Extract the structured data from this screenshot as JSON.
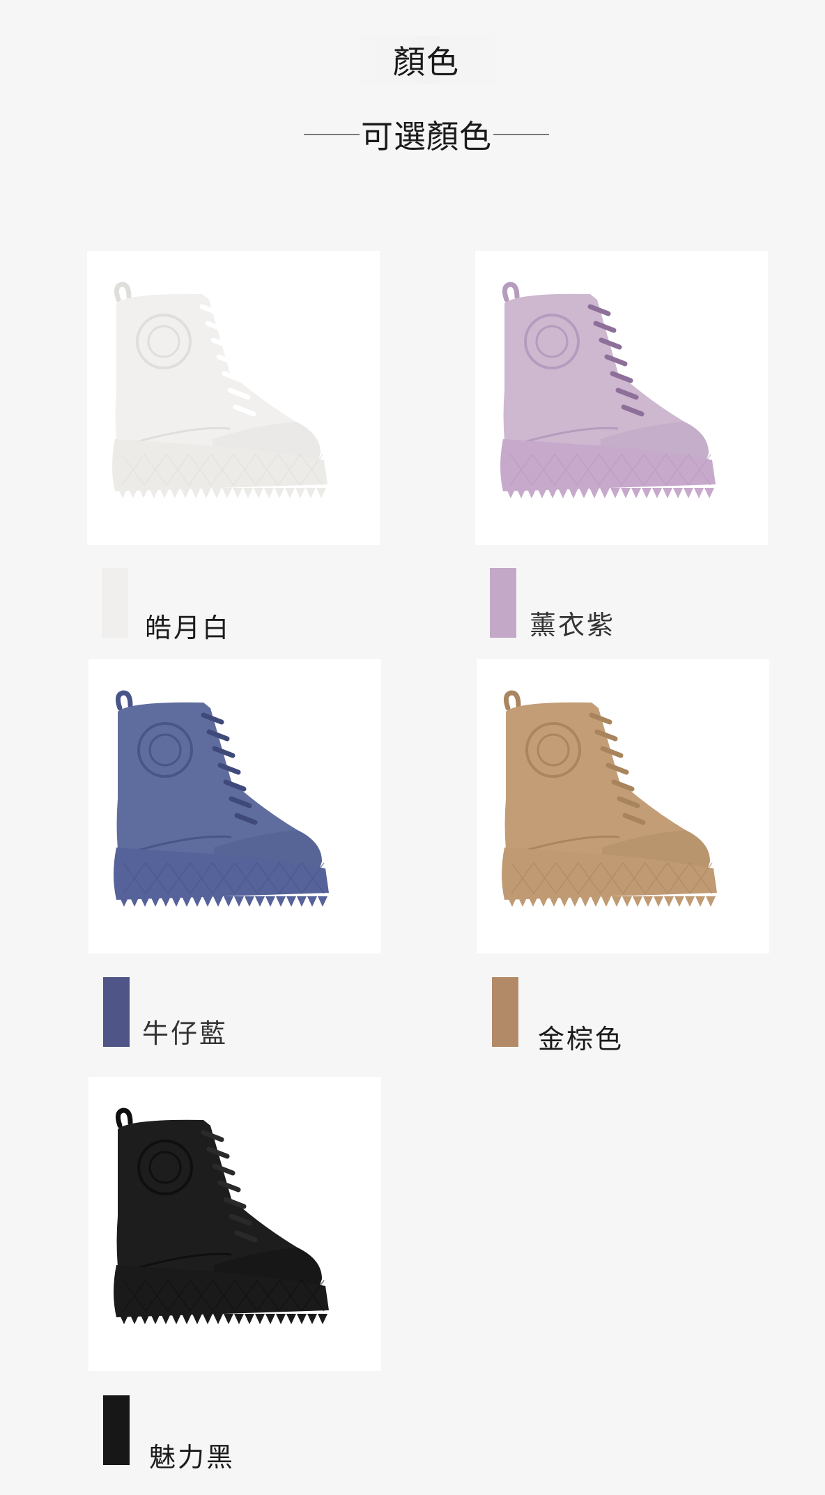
{
  "header": {
    "title": "顏色",
    "subtitle": "可選顏色"
  },
  "colors": [
    {
      "name": "皓月白",
      "swatch": "#f0efee",
      "shoe": "#f1f0ee",
      "shade": "#e0dedb",
      "sole": "#ecebe8",
      "lace": "#ffffff"
    },
    {
      "name": "薰衣紫",
      "swatch": "#c3a8c8",
      "shoe": "#cdb8d0",
      "shade": "#b59bbd",
      "sole": "#c7a9cc",
      "lace": "#8e6f9a"
    },
    {
      "name": "牛仔藍",
      "swatch": "#4f5586",
      "shoe": "#5e6c9e",
      "shade": "#4a5587",
      "sole": "#56629a",
      "lace": "#3f4a7a"
    },
    {
      "name": "金棕色",
      "swatch": "#b38a67",
      "shoe": "#c29d76",
      "shade": "#a98660",
      "sole": "#c09a73",
      "lace": "#a8845c"
    },
    {
      "name": "魅力黑",
      "swatch": "#171717",
      "shoe": "#1d1d1d",
      "shade": "#0f0f0f",
      "sole": "#1a1a1a",
      "lace": "#2a2a2a"
    }
  ]
}
